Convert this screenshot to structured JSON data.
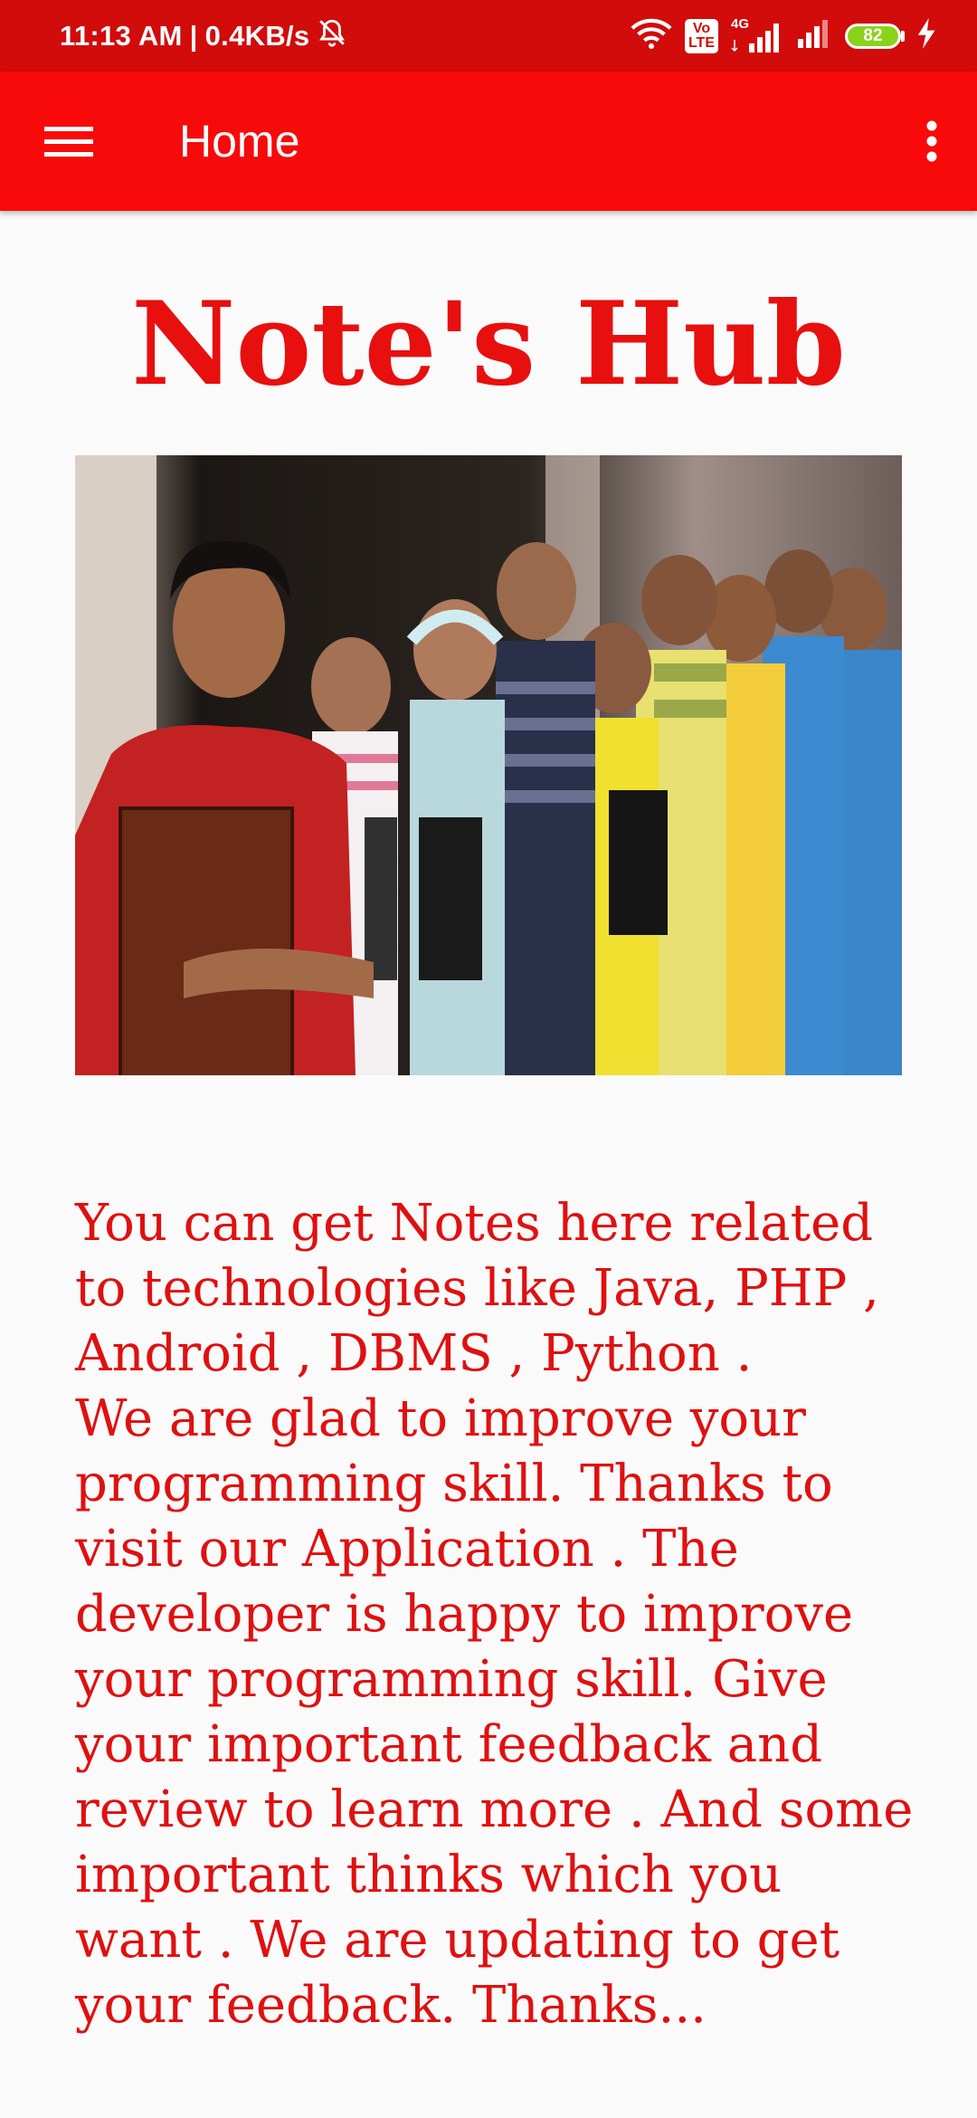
{
  "status_bar": {
    "time": "11:13 AM",
    "separator": "|",
    "speed": "0.4KB/s",
    "volte_line1": "Vo",
    "volte_line2": "LTE",
    "network": "4G",
    "battery_level": "82"
  },
  "app_bar": {
    "title": "Home",
    "menu_icon": "hamburger-menu-icon",
    "overflow_icon": "more-vert-icon"
  },
  "main": {
    "heading": "Note's Hub",
    "image_description": "group-of-students-photo",
    "description": "You can get Notes here related to technologies like Java, PHP , Android , DBMS , Python .\nWe are glad to improve your programming skill. Thanks to visit our Application . The developer is happy to improve your programming skill. Give your important feedback and review to learn more . And some important thinks which you want . We are updating to get your feedback. Thanks..."
  },
  "colors": {
    "status_bar": "#d20b0b",
    "app_bar": "#f80a0a",
    "accent_text": "#e80f0f",
    "background": "#fafafa"
  }
}
